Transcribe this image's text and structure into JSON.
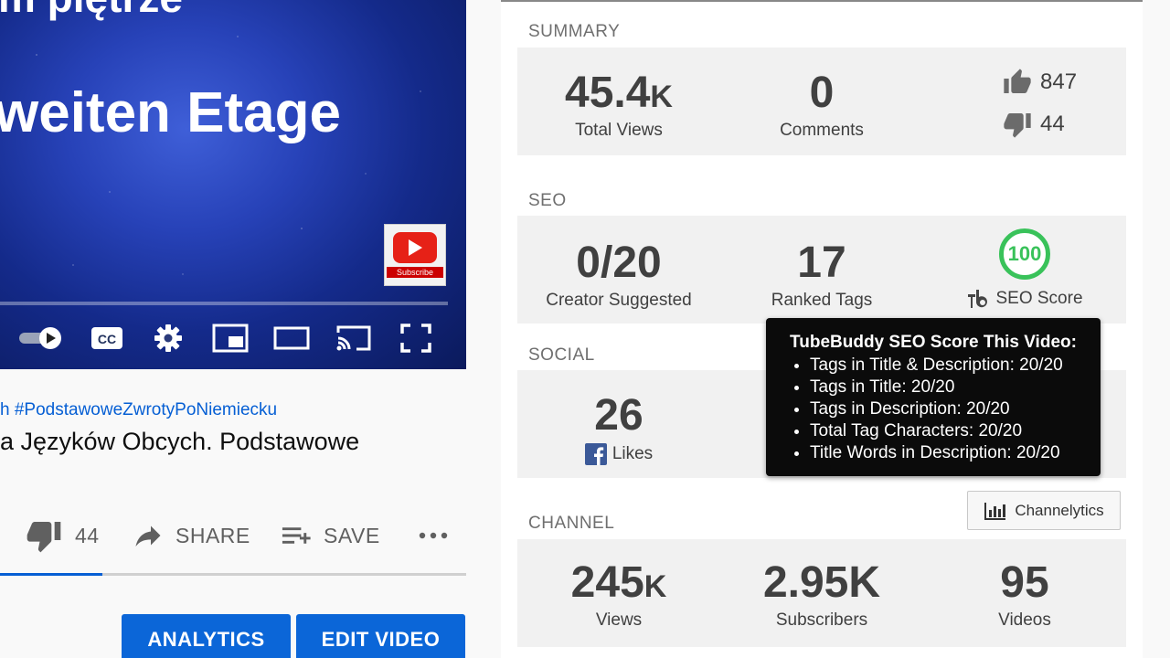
{
  "player": {
    "overlay_top": "m piętrze",
    "overlay_main": "weiten Etage",
    "subscribe_badge_label": "Subscribe"
  },
  "video": {
    "hashtags": "h #PodstawoweZwrotyPoNiemiecku",
    "title": "a Języków Obcych. Podstawowe",
    "dislike_count": "44",
    "share_label": "SHARE",
    "save_label": "SAVE",
    "like_ratio": 0.22
  },
  "buttons": {
    "analytics": "ANALYTICS",
    "edit_video": "EDIT VIDEO"
  },
  "summary": {
    "title": "SUMMARY",
    "views_value": "45.4",
    "views_suffix": "K",
    "views_label": "Total Views",
    "comments_value": "0",
    "comments_label": "Comments",
    "likes": "847",
    "dislikes": "44"
  },
  "seo": {
    "title": "SEO",
    "creator_value": "0/20",
    "creator_label": "Creator Suggested",
    "ranked_value": "17",
    "ranked_label": "Ranked Tags",
    "score_value": "100",
    "score_label": "SEO Score",
    "score_color": "#39c25a"
  },
  "social": {
    "title": "SOCIAL",
    "fb_value": "26",
    "fb_label": "Likes"
  },
  "tooltip": {
    "title": "TubeBuddy SEO Score This Video:",
    "items": [
      "Tags in Title & Description: 20/20",
      "Tags in Title: 20/20",
      "Tags in Description: 20/20",
      "Total Tag Characters: 20/20",
      "Title Words in Description: 20/20"
    ]
  },
  "channel": {
    "title": "CHANNEL",
    "channelytics_label": "Channelytics",
    "views_value": "245",
    "views_suffix": "K",
    "views_label": "Views",
    "subs_value": "2.95K",
    "subs_label": "Subscribers",
    "videos_value": "95",
    "videos_label": "Videos"
  },
  "colors": {
    "accent_blue": "#0b66d8",
    "link_blue": "#065fd4",
    "seo_green": "#39c25a",
    "facebook_blue": "#3b5998"
  }
}
